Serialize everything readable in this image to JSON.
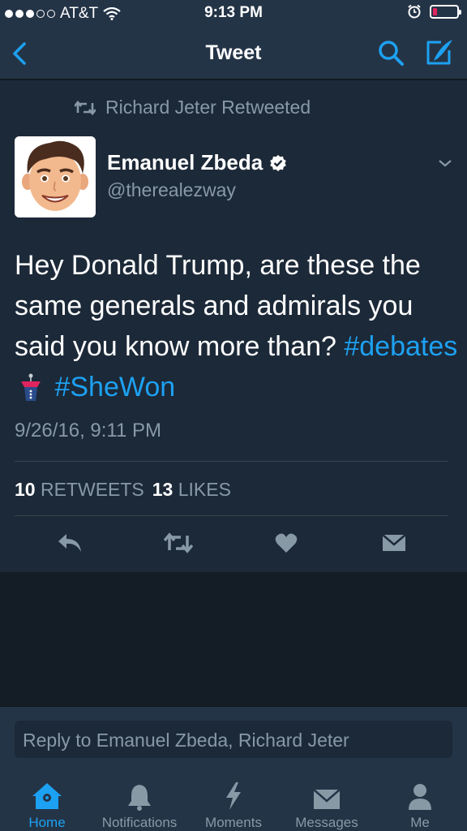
{
  "status_bar": {
    "carrier": "AT&T",
    "time": "9:13 PM"
  },
  "nav": {
    "title": "Tweet",
    "accent_color": "#1da1f2"
  },
  "tweet": {
    "retweeted_by": "Richard Jeter Retweeted",
    "display_name": "Emanuel Zbeda",
    "handle": "@therealezway",
    "verified": true,
    "text_plain": "Hey Donald Trump, are these the same generals and admirals you said you know more than?",
    "hashtags": [
      "#debates",
      "#SheWon"
    ],
    "timestamp": "9/26/16, 9:11 PM",
    "retweets_count": "10",
    "retweets_label": "RETWEETS",
    "likes_count": "13",
    "likes_label": "LIKES"
  },
  "reply": {
    "placeholder": "Reply to Emanuel Zbeda, Richard Jeter"
  },
  "tabs": [
    {
      "label": "Home",
      "icon": "home-icon",
      "active": true
    },
    {
      "label": "Notifications",
      "icon": "bell-icon",
      "active": false
    },
    {
      "label": "Moments",
      "icon": "lightning-icon",
      "active": false
    },
    {
      "label": "Messages",
      "icon": "envelope-icon",
      "active": false
    },
    {
      "label": "Me",
      "icon": "person-icon",
      "active": false
    }
  ]
}
